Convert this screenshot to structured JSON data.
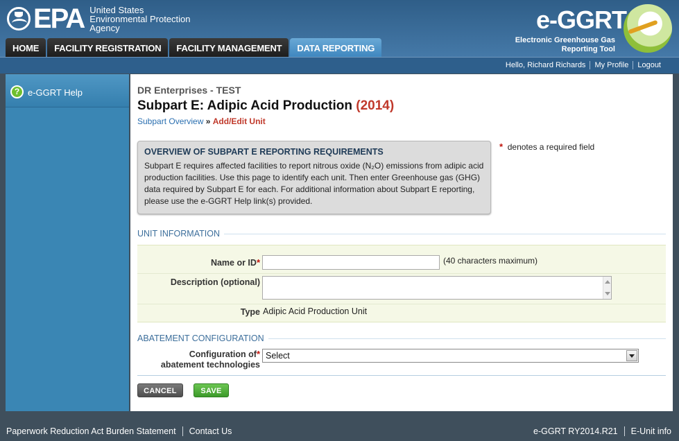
{
  "header": {
    "agency_line1": "United States",
    "agency_line2": "Environmental Protection",
    "agency_line3": "Agency",
    "epa_wordmark": "EPA",
    "brand_title": "e-GGRT",
    "brand_sub1": "Electronic Greenhouse Gas",
    "brand_sub2": "Reporting Tool",
    "tabs": [
      {
        "label": "HOME",
        "active": false
      },
      {
        "label": "FACILITY REGISTRATION",
        "active": false
      },
      {
        "label": "FACILITY MANAGEMENT",
        "active": false
      },
      {
        "label": "DATA REPORTING",
        "active": true
      }
    ]
  },
  "userbar": {
    "greeting": "Hello, Richard Richards",
    "profile": "My Profile",
    "logout": "Logout"
  },
  "sidebar": {
    "help_label": "e-GGRT Help",
    "help_icon": "question-circle-icon"
  },
  "main": {
    "facility": "DR Enterprises - TEST",
    "title": "Subpart E: Adipic Acid Production",
    "year": "(2014)",
    "breadcrumb": {
      "overview": "Subpart Overview",
      "separator": "»",
      "current": "Add/Edit Unit"
    },
    "overview": {
      "heading": "OVERVIEW OF SUBPART E REPORTING REQUIREMENTS",
      "body": "Subpart E requires affected facilities to report nitrous oxide (N₂O) emissions from adipic acid production facilities. Use this page to identify each unit. Then enter Greenhouse gas (GHG) data required by Subpart E for each. For additional information about Subpart E reporting, please use the e-GGRT Help link(s) provided."
    },
    "required_note": "denotes a required field",
    "required_marker": "*",
    "unit_section": "UNIT INFORMATION",
    "name_label": "Name or ID",
    "name_value": "",
    "name_hint": "(40 characters maximum)",
    "description_label": "Description (optional)",
    "description_value": "",
    "type_label": "Type",
    "type_value": "Adipic Acid Production Unit",
    "abatement_section": "ABATEMENT CONFIGURATION",
    "abatement_label_1": "Configuration of",
    "abatement_label_2": "abatement technologies",
    "abatement_selected": "Select",
    "cancel_label": "CANCEL",
    "save_label": "SAVE"
  },
  "footer": {
    "paperwork": "Paperwork Reduction Act Burden Statement",
    "contact": "Contact Us",
    "version": "e-GGRT RY2014.R21",
    "unit_info": "E-Unit info"
  },
  "colors": {
    "header_blue": "#3b6b97",
    "active_tab": "#3f87bf",
    "accent_red": "#c0392b",
    "save_green": "#3c9a2a"
  }
}
